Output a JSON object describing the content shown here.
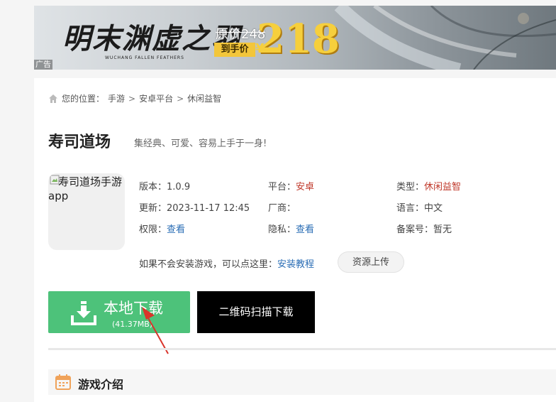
{
  "banner": {
    "logo_text": "明末渊虚之羽",
    "logo_sub": "WUCHANG FALLEN FEATHERS",
    "original_price": "原价248",
    "final_label": "到手价",
    "currency": "¥",
    "final_price": "218",
    "ad_label": "广告"
  },
  "breadcrumb": {
    "prefix": "您的位置：",
    "items": [
      "手游",
      "安卓平台",
      "休闲益智"
    ],
    "separator": ">"
  },
  "game": {
    "title": "寿司道场",
    "slogan": "集经典、可爱、容易上手于一身!",
    "icon_alt": "寿司道场手游app"
  },
  "meta": {
    "version_label": "版本：",
    "version": "1.0.9",
    "platform_label": "平台：",
    "platform": "安卓",
    "type_label": "类型：",
    "type": "休闲益智",
    "updated_label": "更新：",
    "updated": "2023-11-17 12:45",
    "vendor_label": "厂商：",
    "vendor": "",
    "language_label": "语言：",
    "language": "中文",
    "permission_label": "权限：",
    "permission": "查看",
    "privacy_label": "隐私：",
    "privacy": "查看",
    "record_label": "备案号：",
    "record": "暂无"
  },
  "install": {
    "tip": "如果不会安装游戏，可以点这里：",
    "tutorial": "安装教程",
    "upload": "资源上传"
  },
  "download": {
    "local_label": "本地下载",
    "size": "(41.37MB)",
    "qr_label": "二维码扫描下载"
  },
  "section": {
    "intro_title": "游戏介绍"
  },
  "colors": {
    "download_green": "#4dc27a",
    "link_blue": "#2a6db5",
    "accent_red": "#c0392b",
    "price_gold": "#f6cf3c"
  }
}
